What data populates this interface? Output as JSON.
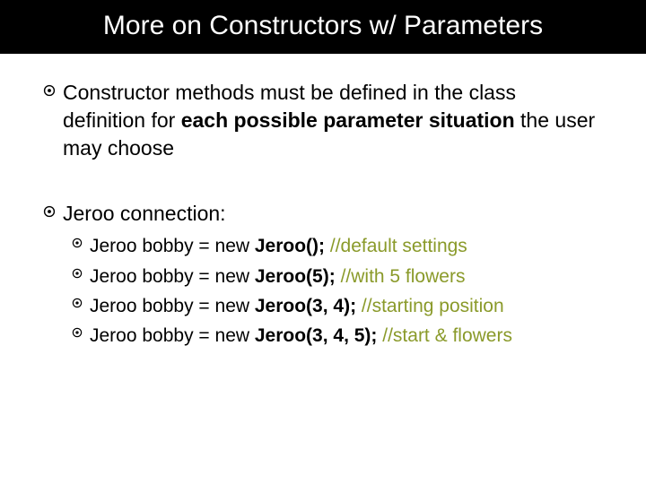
{
  "title": "More on Constructors w/ Parameters",
  "b1": {
    "pre": "Constructor methods must be defined in the class definition for ",
    "bold": "each possible parameter situation",
    "post": " the user may choose"
  },
  "b2": {
    "label": "Jeroo connection:",
    "examples": [
      {
        "prefix": "Jeroo bobby = new ",
        "call": "Jeroo();",
        "comment": " //default settings"
      },
      {
        "prefix": "Jeroo bobby = new ",
        "call": "Jeroo(5);",
        "comment": " //with 5 flowers"
      },
      {
        "prefix": "Jeroo bobby = new ",
        "call": "Jeroo(3, 4);",
        "comment": " //starting position"
      },
      {
        "prefix": "Jeroo bobby = new ",
        "call": "Jeroo(3, 4, 5);",
        "comment": " //start & flowers"
      }
    ]
  }
}
